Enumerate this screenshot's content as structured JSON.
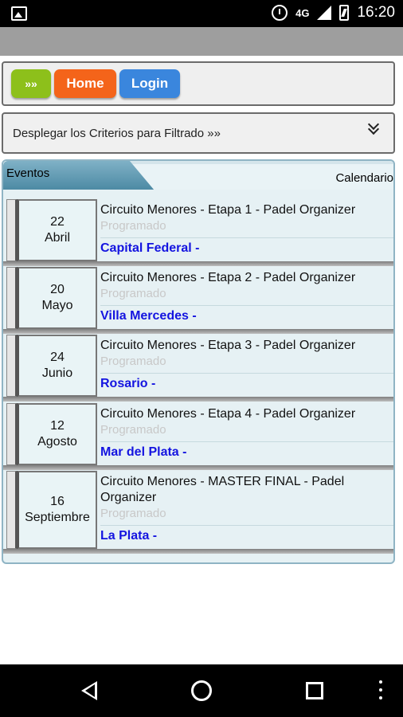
{
  "status_bar": {
    "network": "4G",
    "time": "16:20"
  },
  "toolbar": {
    "more_label": "»»",
    "home_label": "Home",
    "login_label": "Login"
  },
  "filter": {
    "label": "Desplegar los Criterios para Filtrado »»"
  },
  "tabs": {
    "eventos": "Eventos",
    "calendario": "Calendario"
  },
  "events": [
    {
      "day": "22",
      "month": "Abril",
      "title": "Circuito Menores - Etapa 1 - Padel Organizer",
      "status": "Programado",
      "location": "Capital Federal -"
    },
    {
      "day": "20",
      "month": "Mayo",
      "title": "Circuito Menores - Etapa 2 - Padel Organizer",
      "status": "Programado",
      "location": "Villa Mercedes -"
    },
    {
      "day": "24",
      "month": "Junio",
      "title": "Circuito Menores - Etapa 3 - Padel Organizer",
      "status": "Programado",
      "location": "Rosario -"
    },
    {
      "day": "12",
      "month": "Agosto",
      "title": "Circuito Menores - Etapa 4 - Padel Organizer",
      "status": "Programado",
      "location": "Mar del Plata -"
    },
    {
      "day": "16",
      "month": "Septiembre",
      "title": "Circuito Menores - MASTER FINAL - Padel Organizer",
      "status": "Programado",
      "location": "La Plata -"
    }
  ],
  "colors": {
    "more_button": "#8dc01b",
    "home_button": "#f4641a",
    "login_button": "#3a86dd",
    "location_text": "#1414e0"
  }
}
